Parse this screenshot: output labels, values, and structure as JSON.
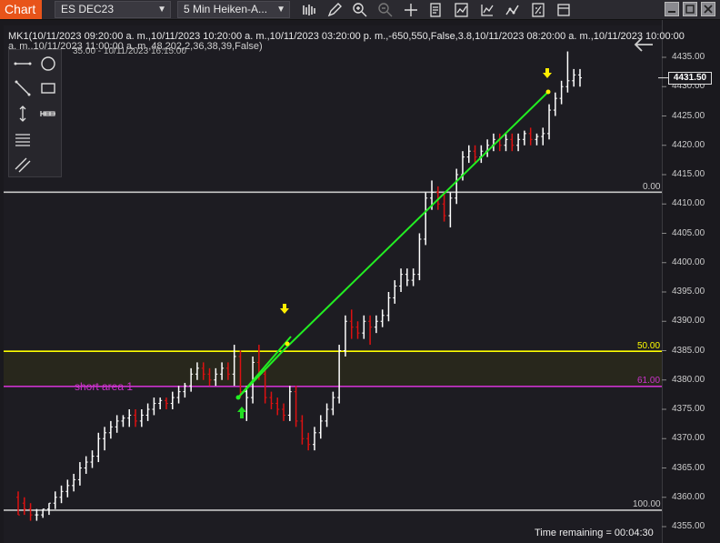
{
  "toolbar": {
    "tab_label": "Chart",
    "instrument": "ES DEC23",
    "interval": "5 Min Heiken-A...",
    "icons": [
      "bar-type-icon",
      "pencil-icon",
      "zoom-in-icon",
      "zoom-out-icon",
      "crosshair-icon",
      "properties-icon",
      "indicators-icon",
      "strategies-icon",
      "chart-trader-icon"
    ],
    "window_buttons": [
      "minimize-icon",
      "maximize-icon",
      "close-icon"
    ]
  },
  "chart": {
    "header_line1": "MK1(10/11/2023 09:20:00 a. m.,10/11/2023 10:20:00 a. m.,10/11/2023 03:20:00 p. m.,-650,550,False,3.8,10/11/2023 08:20:00 a. m.,10/11/2023 10:00:00",
    "header_line2": "a. m.,10/11/2023 11:00:00 a. m.,48,202,2,36,38,39,False)",
    "header_overlap": "35.00 - 10/11/2023 16:15:00",
    "zone_label": "short area 1",
    "fib_labels": {
      "top": "0.00",
      "mid": "50.00",
      "lower": "61.00",
      "bottom": "100.00"
    },
    "time_remaining": "Time remaining = 00:04:30",
    "last_price": "4431.50",
    "colors": {
      "fib_top": "#c8c8c8",
      "fib_50": "#ffff00",
      "fib_61": "#cc33cc",
      "fib_100": "#c8c8c8",
      "trend": "#22ee22",
      "up_bar": "#ffffff",
      "down_bar": "#dd1111",
      "sell_arrow": "#ffee00",
      "buy_arrow": "#22dd22",
      "toolbar_accent": "#e8541a"
    }
  },
  "chart_data": {
    "type": "candlestick",
    "ylim": [
      4353.5,
      4437.5
    ],
    "yticks": [
      4435.0,
      4430.0,
      4425.0,
      4420.0,
      4415.0,
      4410.0,
      4405.0,
      4400.0,
      4395.0,
      4390.0,
      4385.0,
      4380.0,
      4375.0,
      4370.0,
      4365.0,
      4360.0,
      4355.0
    ],
    "levels": [
      {
        "label": "0.00",
        "price": 4412.0
      },
      {
        "label": "50.00",
        "price": 4384.9
      },
      {
        "label": "61.00",
        "price": 4378.9
      },
      {
        "label": "100.00",
        "price": 4357.8
      }
    ],
    "last_price": 4431.5,
    "bars": [
      {
        "o": 4360,
        "h": 4361,
        "l": 4357,
        "c": 4357,
        "d": 1
      },
      {
        "o": 4359,
        "h": 4360,
        "l": 4357,
        "c": 4358,
        "d": 1
      },
      {
        "o": 4358,
        "h": 4359,
        "l": 4356,
        "c": 4357,
        "d": 1
      },
      {
        "o": 4357,
        "h": 4358,
        "l": 4356,
        "c": 4357,
        "d": 0
      },
      {
        "o": 4357,
        "h": 4358,
        "l": 4356.5,
        "c": 4358,
        "d": 0
      },
      {
        "o": 4358,
        "h": 4359,
        "l": 4357,
        "c": 4359,
        "d": 0
      },
      {
        "o": 4359,
        "h": 4361,
        "l": 4358,
        "c": 4360,
        "d": 0
      },
      {
        "o": 4360,
        "h": 4362,
        "l": 4359,
        "c": 4361,
        "d": 0
      },
      {
        "o": 4361,
        "h": 4363,
        "l": 4360,
        "c": 4362,
        "d": 0
      },
      {
        "o": 4362,
        "h": 4364,
        "l": 4361,
        "c": 4363,
        "d": 0
      },
      {
        "o": 4363,
        "h": 4366,
        "l": 4362,
        "c": 4365,
        "d": 0
      },
      {
        "o": 4365,
        "h": 4367,
        "l": 4364,
        "c": 4366,
        "d": 0
      },
      {
        "o": 4366,
        "h": 4368,
        "l": 4365,
        "c": 4367,
        "d": 0
      },
      {
        "o": 4367,
        "h": 4371,
        "l": 4366,
        "c": 4370,
        "d": 0
      },
      {
        "o": 4370,
        "h": 4372,
        "l": 4368,
        "c": 4371,
        "d": 0
      },
      {
        "o": 4371,
        "h": 4373,
        "l": 4370,
        "c": 4372,
        "d": 0
      },
      {
        "o": 4372,
        "h": 4374,
        "l": 4371,
        "c": 4373,
        "d": 0
      },
      {
        "o": 4373,
        "h": 4374,
        "l": 4372,
        "c": 4373.5,
        "d": 0
      },
      {
        "o": 4373.5,
        "h": 4375,
        "l": 4372,
        "c": 4374,
        "d": 0
      },
      {
        "o": 4374,
        "h": 4375,
        "l": 4372,
        "c": 4373,
        "d": 1
      },
      {
        "o": 4373,
        "h": 4375,
        "l": 4372,
        "c": 4374,
        "d": 0
      },
      {
        "o": 4374,
        "h": 4376,
        "l": 4373,
        "c": 4375,
        "d": 0
      },
      {
        "o": 4375,
        "h": 4377,
        "l": 4374,
        "c": 4376,
        "d": 0
      },
      {
        "o": 4376,
        "h": 4377,
        "l": 4375,
        "c": 4376.5,
        "d": 0
      },
      {
        "o": 4376.5,
        "h": 4377,
        "l": 4375,
        "c": 4376,
        "d": 1
      },
      {
        "o": 4376,
        "h": 4378,
        "l": 4375,
        "c": 4377,
        "d": 0
      },
      {
        "o": 4377,
        "h": 4379,
        "l": 4376,
        "c": 4378,
        "d": 0
      },
      {
        "o": 4378,
        "h": 4379.5,
        "l": 4377,
        "c": 4379,
        "d": 0
      },
      {
        "o": 4379,
        "h": 4382,
        "l": 4378,
        "c": 4381,
        "d": 0
      },
      {
        "o": 4381,
        "h": 4383,
        "l": 4380,
        "c": 4382,
        "d": 0
      },
      {
        "o": 4382,
        "h": 4383,
        "l": 4380,
        "c": 4381,
        "d": 1
      },
      {
        "o": 4381,
        "h": 4382,
        "l": 4379,
        "c": 4380,
        "d": 1
      },
      {
        "o": 4380,
        "h": 4382,
        "l": 4379,
        "c": 4381,
        "d": 0
      },
      {
        "o": 4381,
        "h": 4383,
        "l": 4380,
        "c": 4382,
        "d": 0
      },
      {
        "o": 4382,
        "h": 4383,
        "l": 4380,
        "c": 4381,
        "d": 1
      },
      {
        "o": 4381,
        "h": 4386,
        "l": 4379,
        "c": 4384,
        "d": 0
      },
      {
        "o": 4384,
        "h": 4385,
        "l": 4377,
        "c": 4378,
        "d": 1
      },
      {
        "o": 4378,
        "h": 4379,
        "l": 4373,
        "c": 4377,
        "d": 0
      },
      {
        "o": 4377,
        "h": 4384,
        "l": 4376,
        "c": 4383,
        "d": 0
      },
      {
        "o": 4383,
        "h": 4386,
        "l": 4380,
        "c": 4381,
        "d": 1
      },
      {
        "o": 4381,
        "h": 4382,
        "l": 4376,
        "c": 4377,
        "d": 1
      },
      {
        "o": 4377,
        "h": 4378,
        "l": 4375,
        "c": 4376,
        "d": 1
      },
      {
        "o": 4376,
        "h": 4377,
        "l": 4374,
        "c": 4375,
        "d": 1
      },
      {
        "o": 4375,
        "h": 4376,
        "l": 4373,
        "c": 4374,
        "d": 1
      },
      {
        "o": 4374,
        "h": 4379,
        "l": 4373,
        "c": 4378,
        "d": 0
      },
      {
        "o": 4378,
        "h": 4379,
        "l": 4372,
        "c": 4373,
        "d": 1
      },
      {
        "o": 4373,
        "h": 4374,
        "l": 4369,
        "c": 4370,
        "d": 1
      },
      {
        "o": 4370,
        "h": 4371,
        "l": 4368,
        "c": 4369,
        "d": 1
      },
      {
        "o": 4369,
        "h": 4372,
        "l": 4368,
        "c": 4371,
        "d": 0
      },
      {
        "o": 4371,
        "h": 4374,
        "l": 4370,
        "c": 4373,
        "d": 0
      },
      {
        "o": 4373,
        "h": 4376,
        "l": 4372,
        "c": 4375,
        "d": 0
      },
      {
        "o": 4375,
        "h": 4378,
        "l": 4374,
        "c": 4377,
        "d": 0
      },
      {
        "o": 4377,
        "h": 4386,
        "l": 4376,
        "c": 4385,
        "d": 0
      },
      {
        "o": 4385,
        "h": 4391,
        "l": 4384,
        "c": 4390,
        "d": 0
      },
      {
        "o": 4390,
        "h": 4392,
        "l": 4387,
        "c": 4389,
        "d": 1
      },
      {
        "o": 4389,
        "h": 4390,
        "l": 4387,
        "c": 4388,
        "d": 1
      },
      {
        "o": 4388,
        "h": 4391,
        "l": 4387,
        "c": 4390,
        "d": 0
      },
      {
        "o": 4390,
        "h": 4391,
        "l": 4386,
        "c": 4389,
        "d": 1
      },
      {
        "o": 4389,
        "h": 4391,
        "l": 4388,
        "c": 4390,
        "d": 0
      },
      {
        "o": 4390,
        "h": 4392,
        "l": 4389,
        "c": 4391,
        "d": 0
      },
      {
        "o": 4391,
        "h": 4395,
        "l": 4390,
        "c": 4394,
        "d": 0
      },
      {
        "o": 4394,
        "h": 4397,
        "l": 4393,
        "c": 4396,
        "d": 0
      },
      {
        "o": 4396,
        "h": 4399,
        "l": 4395,
        "c": 4398,
        "d": 0
      },
      {
        "o": 4398,
        "h": 4399,
        "l": 4396,
        "c": 4397,
        "d": 0
      },
      {
        "o": 4397,
        "h": 4399,
        "l": 4396,
        "c": 4398,
        "d": 0
      },
      {
        "o": 4398,
        "h": 4405,
        "l": 4397,
        "c": 4404,
        "d": 0
      },
      {
        "o": 4404,
        "h": 4412,
        "l": 4403,
        "c": 4411,
        "d": 0
      },
      {
        "o": 4411,
        "h": 4414,
        "l": 4409,
        "c": 4412,
        "d": 0
      },
      {
        "o": 4412,
        "h": 4413,
        "l": 4409,
        "c": 4410,
        "d": 1
      },
      {
        "o": 4410,
        "h": 4412,
        "l": 4407,
        "c": 4408,
        "d": 1
      },
      {
        "o": 4408,
        "h": 4412,
        "l": 4406,
        "c": 4411,
        "d": 0
      },
      {
        "o": 4411,
        "h": 4416,
        "l": 4410,
        "c": 4415,
        "d": 0
      },
      {
        "o": 4415,
        "h": 4419,
        "l": 4414,
        "c": 4418,
        "d": 0
      },
      {
        "o": 4418,
        "h": 4420,
        "l": 4417,
        "c": 4419,
        "d": 0
      },
      {
        "o": 4419,
        "h": 4420,
        "l": 4417,
        "c": 4418,
        "d": 1
      },
      {
        "o": 4418,
        "h": 4420,
        "l": 4417,
        "c": 4419,
        "d": 0
      },
      {
        "o": 4419,
        "h": 4421,
        "l": 4418,
        "c": 4420,
        "d": 0
      },
      {
        "o": 4420,
        "h": 4422,
        "l": 4419,
        "c": 4421,
        "d": 0
      },
      {
        "o": 4421,
        "h": 4422,
        "l": 4419,
        "c": 4420,
        "d": 1
      },
      {
        "o": 4420,
        "h": 4422,
        "l": 4419,
        "c": 4421,
        "d": 0
      },
      {
        "o": 4421,
        "h": 4422,
        "l": 4419,
        "c": 4420,
        "d": 1
      },
      {
        "o": 4420,
        "h": 4422,
        "l": 4419,
        "c": 4421,
        "d": 0
      },
      {
        "o": 4421,
        "h": 4422.5,
        "l": 4420,
        "c": 4422,
        "d": 0
      },
      {
        "o": 4422,
        "h": 4423,
        "l": 4420,
        "c": 4421,
        "d": 1
      },
      {
        "o": 4421,
        "h": 4422,
        "l": 4420,
        "c": 4421.5,
        "d": 0
      },
      {
        "o": 4421.5,
        "h": 4423,
        "l": 4420,
        "c": 4422,
        "d": 0
      },
      {
        "o": 4422,
        "h": 4427,
        "l": 4421,
        "c": 4426,
        "d": 0
      },
      {
        "o": 4426,
        "h": 4429,
        "l": 4425,
        "c": 4428,
        "d": 0
      },
      {
        "o": 4428,
        "h": 4431,
        "l": 4427,
        "c": 4430,
        "d": 0
      },
      {
        "o": 4430,
        "h": 4436,
        "l": 4429,
        "c": 4431,
        "d": 0
      },
      {
        "o": 4431,
        "h": 4433,
        "l": 4430,
        "c": 4432,
        "d": 0
      },
      {
        "o": 4432,
        "h": 4433,
        "l": 4430,
        "c": 4431.5,
        "d": 0
      }
    ]
  }
}
